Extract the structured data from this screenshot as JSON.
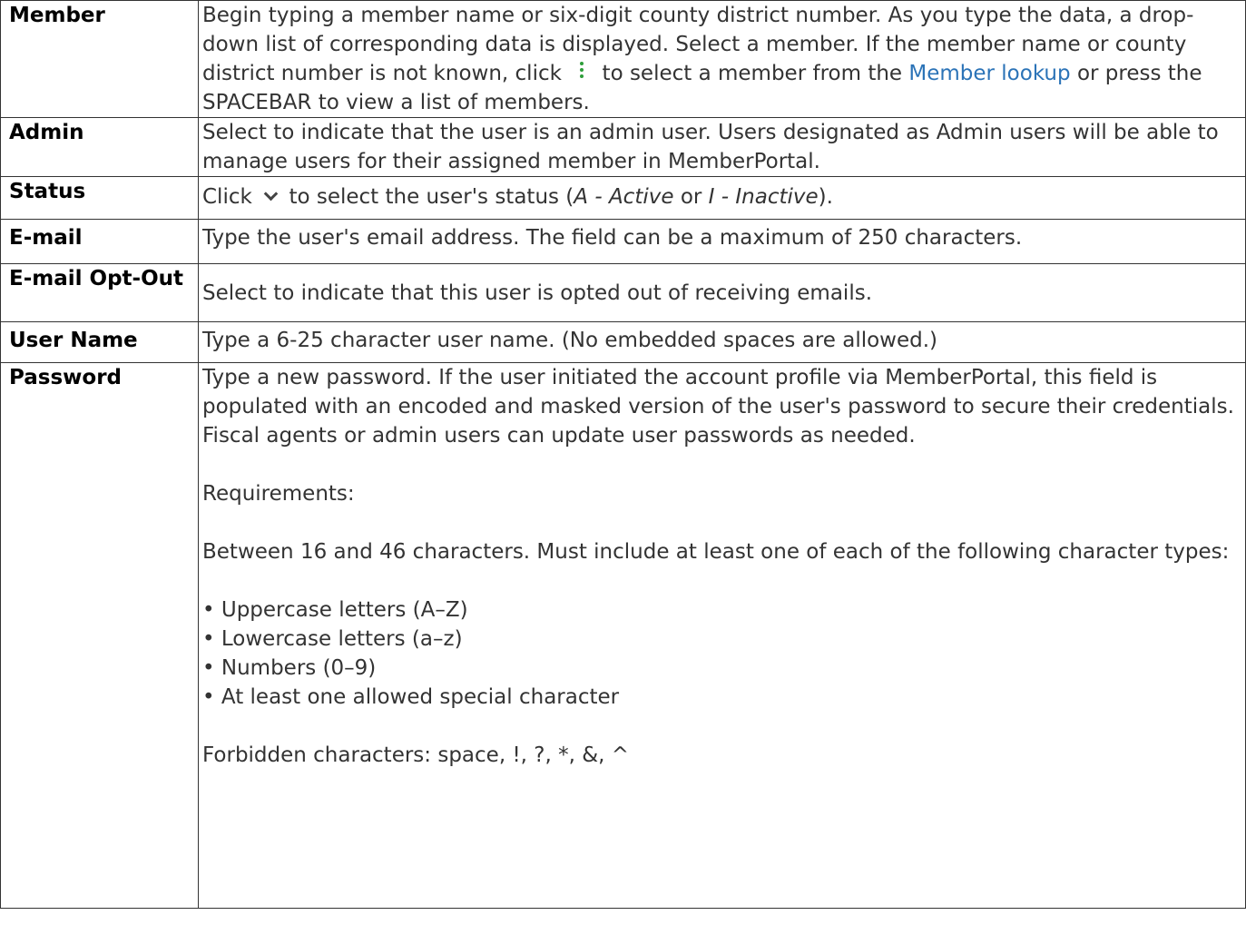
{
  "rows": {
    "member": {
      "label": "Member",
      "text_1": "Begin typing a member name or six-digit county district number. As you type the data, a drop-down list of corresponding data is displayed. Select a member. If the member name or county district number is not known, click",
      "icon": "kebab-menu-icon",
      "text_2": "to select a member from the",
      "link": "Member lookup",
      "text_3": "or press the SPACEBAR to view a list of members."
    },
    "admin": {
      "label": "Admin",
      "text": "Select to indicate that the user is an admin user. Users designated as Admin users will be able to manage users for their assigned member in MemberPortal."
    },
    "status": {
      "label": "Status",
      "text_1": "Click",
      "icon": "chevron-down-icon",
      "text_2": "to select the user's status (",
      "option_active": "A - Active",
      "text_3": "or",
      "option_inactive": "I - Inactive",
      "text_4": ")."
    },
    "email": {
      "label": "E-mail",
      "text": "Type the user's email address. The field can be a maximum of 250 characters."
    },
    "optout": {
      "label": "E-mail Opt-Out",
      "text": "Select to indicate that this user is opted out of receiving emails."
    },
    "username": {
      "label": "User Name",
      "text": "Type a 6-25 character user name. (No embedded spaces are allowed.)"
    },
    "password": {
      "label": "Password",
      "para_1": "Type a new password. If the user initiated the account profile via MemberPortal, this field is populated with an encoded and masked version of the user's password to secure their credentials. Fiscal agents or admin users can update user passwords as needed.",
      "para_2": "Requirements:",
      "para_3": "Between 16 and 46 characters. Must include at least one of each of the following character types:",
      "bullets": [
        "• Uppercase letters (A–Z)",
        "• Lowercase letters (a–z)",
        "• Numbers (0–9)",
        "• At least one allowed special character"
      ],
      "para_4": "Forbidden characters: space, !, ?, *, &, ^"
    }
  },
  "colors": {
    "link": "#2b73b7",
    "border": "#333333",
    "icon_green": "#2e9e3a"
  }
}
